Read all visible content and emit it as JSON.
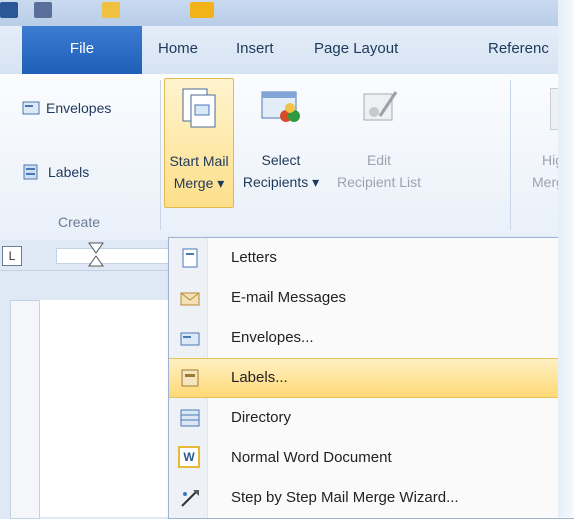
{
  "ribbon_tabs": {
    "file": "File",
    "home": "Home",
    "insert": "Insert",
    "page_layout": "Page Layout",
    "references": "Referenc"
  },
  "create_group": {
    "envelopes": "Envelopes",
    "labels": "Labels",
    "group_label": "Create"
  },
  "start_group": {
    "start_mail_merge_line1": "Start Mail",
    "start_mail_merge_line2": "Merge ▾",
    "select_recipients_line1": "Select",
    "select_recipients_line2": "Recipients ▾",
    "edit_recipient_list_line1": "Edit",
    "edit_recipient_list_line2": "Recipient List",
    "highlight_line1": "Hig",
    "highlight_line2": "Merg"
  },
  "menu": {
    "items": [
      {
        "label": "Letters",
        "icon": "letter-icon"
      },
      {
        "label": "E-mail Messages",
        "icon": "email-icon"
      },
      {
        "label": "Envelopes...",
        "icon": "envelope-icon"
      },
      {
        "label": "Labels...",
        "icon": "labels-icon"
      },
      {
        "label": "Directory",
        "icon": "directory-icon"
      },
      {
        "label": "Normal Word Document",
        "icon": "word-document-icon"
      },
      {
        "label": "Step by Step Mail Merge Wizard...",
        "icon": "wizard-icon"
      }
    ],
    "highlighted_index": 3
  },
  "colors": {
    "file_tab": "#1f5fb8",
    "menu_highlight": "#ffd875",
    "start_mail_merge_highlight": "#fde39a"
  }
}
